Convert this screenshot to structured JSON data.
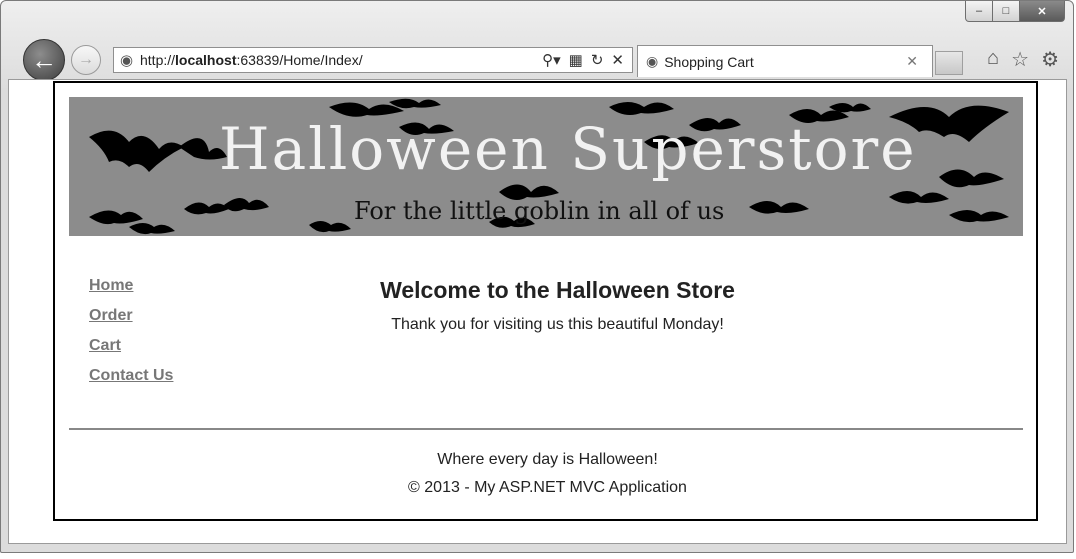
{
  "browser": {
    "url_prefix": "http://",
    "url_host": "localhost",
    "url_rest": ":63839/Home/Index/",
    "tab_title": "Shopping Cart",
    "window_controls": {
      "minimize": "–",
      "maximize": "□",
      "close": "✕"
    }
  },
  "banner": {
    "title": "Halloween Superstore",
    "tagline": "For the little goblin in all of us"
  },
  "nav": {
    "items": [
      "Home",
      "Order",
      "Cart",
      "Contact Us"
    ]
  },
  "main": {
    "heading": "Welcome to the Halloween Store",
    "message": "Thank you for visiting us this beautiful Monday!"
  },
  "footer": {
    "line1": "Where every day is Halloween!",
    "line2": "© 2013 - My ASP.NET MVC Application"
  },
  "colors": {
    "banner_bg": "#8c8c8c",
    "nav_link": "#777777",
    "page_border": "#000000"
  }
}
